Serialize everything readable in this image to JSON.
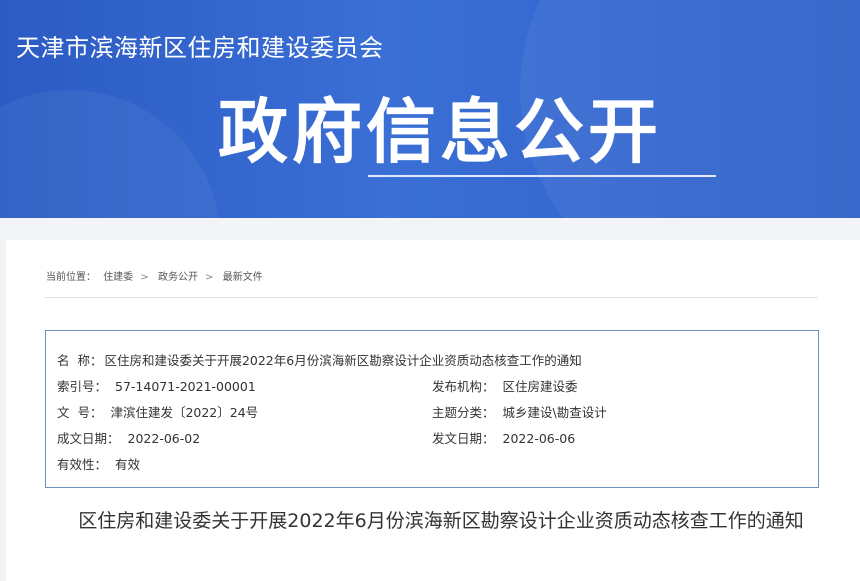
{
  "banner": {
    "org_name": "天津市滨海新区住房和建设委员会",
    "heading": "政府信息公开"
  },
  "breadcrumb": {
    "prefix": "当前位置：",
    "items": [
      "住建委",
      "政务公开",
      "最新文件"
    ],
    "separator": ">"
  },
  "meta": {
    "name_label": "名  称：",
    "name_value": "区住房和建设委关于开展2022年6月份滨海新区勘察设计企业资质动态核查工作的通知",
    "index_label": "索引号：",
    "index_value": "57-14071-2021-00001",
    "publisher_label": "发布机构：",
    "publisher_value": "区住房建设委",
    "docno_label": "文  号：",
    "docno_value": "津滨住建发〔2022〕24号",
    "topic_label": "主题分类：",
    "topic_value": "城乡建设\\勘查设计",
    "created_label": "成文日期：",
    "created_value": "2022-06-02",
    "issued_label": "发文日期：",
    "issued_value": "2022-06-06",
    "validity_label": "有效性：",
    "validity_value": "有效"
  },
  "article": {
    "title": "区住房和建设委关于开展2022年6月份滨海新区勘察设计企业资质动态核查工作的通知"
  },
  "colors": {
    "banner_blue": "#2f60c8",
    "border_blue": "#6f8fc0"
  }
}
